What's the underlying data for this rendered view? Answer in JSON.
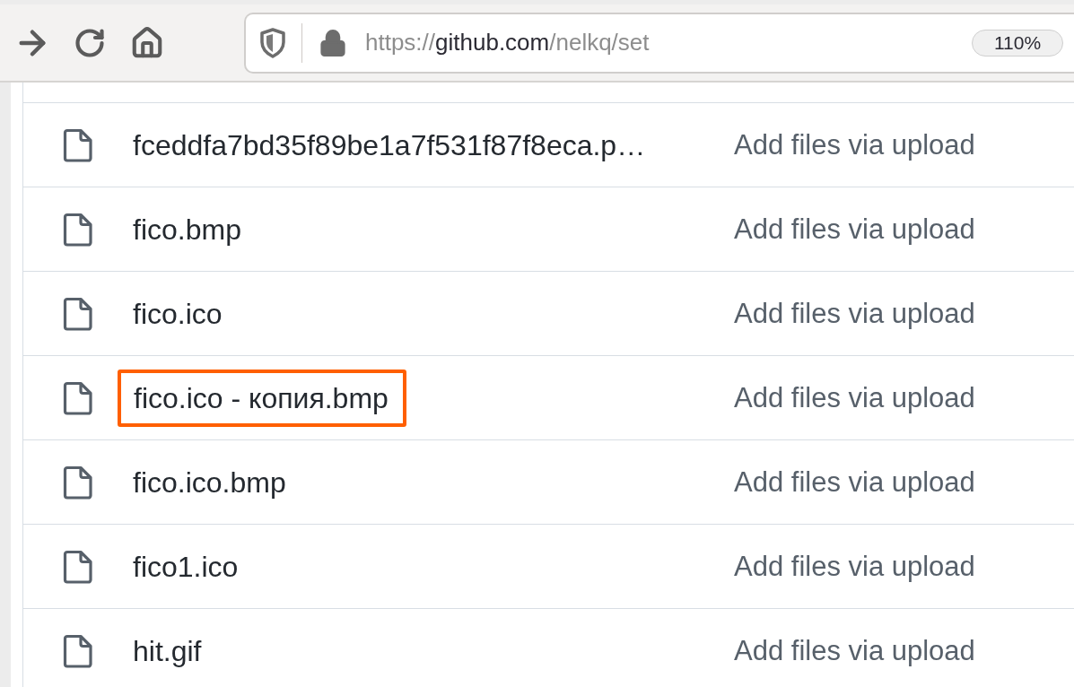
{
  "toolbar": {
    "url": {
      "scheme": "https://",
      "host": "github.com",
      "path": "/nelkq/set"
    },
    "zoom": "110%"
  },
  "files": [
    {
      "name": "fceddfa7bd35f89be1a7f531f87f8eca.p…",
      "message": "Add files via upload",
      "highlighted": false
    },
    {
      "name": "fico.bmp",
      "message": "Add files via upload",
      "highlighted": false
    },
    {
      "name": "fico.ico",
      "message": "Add files via upload",
      "highlighted": false
    },
    {
      "name": "fico.ico - копия.bmp",
      "message": "Add files via upload",
      "highlighted": true
    },
    {
      "name": "fico.ico.bmp",
      "message": "Add files via upload",
      "highlighted": false
    },
    {
      "name": "fico1.ico",
      "message": "Add files via upload",
      "highlighted": false
    },
    {
      "name": "hit.gif",
      "message": "Add files via upload",
      "highlighted": false
    }
  ]
}
